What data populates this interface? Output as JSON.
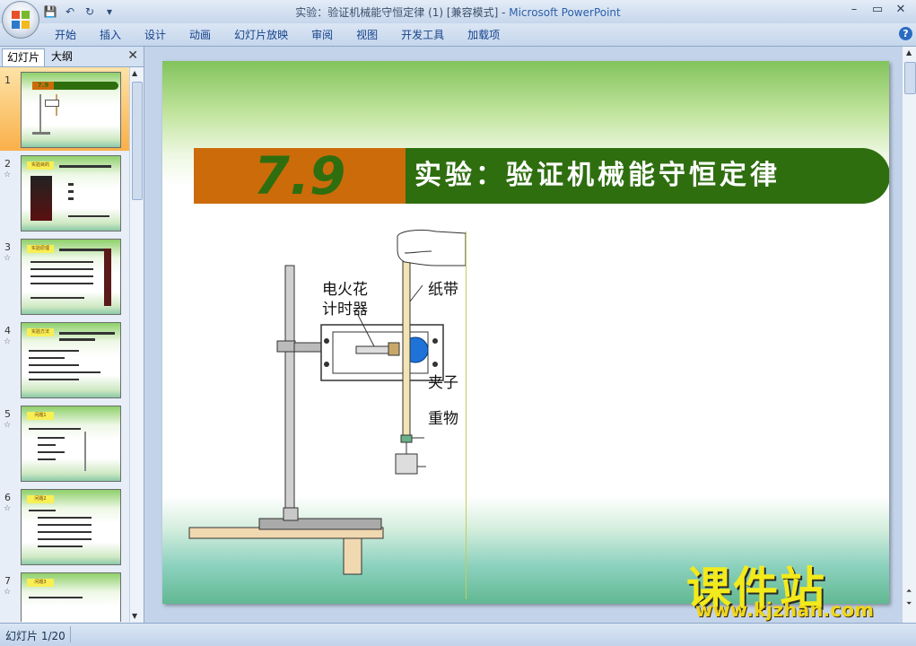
{
  "window": {
    "title": "实验：验证机械能守恒定律 (1) [兼容模式]",
    "app_name": "Microsoft PowerPoint",
    "controls": [
      "–",
      "▭",
      "✕"
    ]
  },
  "qat": {
    "save": "💾",
    "undo": "↶",
    "redo": "↻",
    "customize": "▾"
  },
  "ribbon": {
    "tabs": [
      "开始",
      "插入",
      "设计",
      "动画",
      "幻灯片放映",
      "审阅",
      "视图",
      "开发工具",
      "加载项"
    ],
    "help": "?"
  },
  "left_pane": {
    "tabs": {
      "slides": "幻灯片",
      "outline": "大纲"
    },
    "close": "✕",
    "thumbnails": [
      {
        "num": "1",
        "star": "",
        "head": "7.9"
      },
      {
        "num": "2",
        "star": "☆",
        "head": "实验目的"
      },
      {
        "num": "3",
        "star": "☆",
        "head": "实验原理"
      },
      {
        "num": "4",
        "star": "☆",
        "head": "实验方法"
      },
      {
        "num": "5",
        "star": "☆",
        "head": "问题1"
      },
      {
        "num": "6",
        "star": "☆",
        "head": "问题2"
      },
      {
        "num": "7",
        "star": "☆",
        "head": "问题3"
      }
    ]
  },
  "slide": {
    "number": "7.9",
    "title": "实验：验证机械能守恒定律",
    "labels": {
      "timer": "电火花",
      "timer2": "计时器",
      "tape": "纸带",
      "clip": "夹子",
      "weight": "重物"
    },
    "watermark_cn": "课件站",
    "watermark_url": "www.kjzhan.com"
  },
  "status": {
    "text": "幻灯片 1/20"
  },
  "colors": {
    "title_orange": "#cc6b0a",
    "title_green": "#2e6e0f",
    "watermark": "#f3ea1c"
  }
}
